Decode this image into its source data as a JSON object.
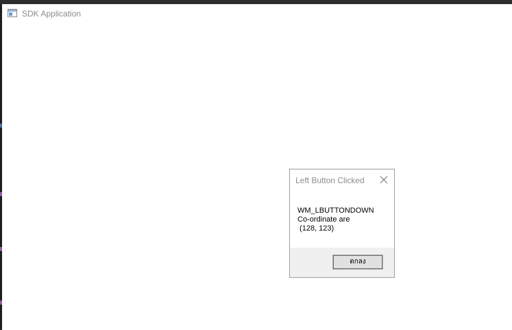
{
  "main_window": {
    "title": "SDK Application",
    "app_icon": "window-icon"
  },
  "message_box": {
    "title": "Left Button Clicked",
    "close_icon": "close-icon",
    "message": "WM_LBUTTONDOWN\nCo-ordinate are\n (128, 123)",
    "ok_label": "ตกลง"
  },
  "colors": {
    "titlebar_text": "#8c8c8c",
    "dialog_footer": "#f0f0f0",
    "button_face": "#e1e1e1"
  }
}
